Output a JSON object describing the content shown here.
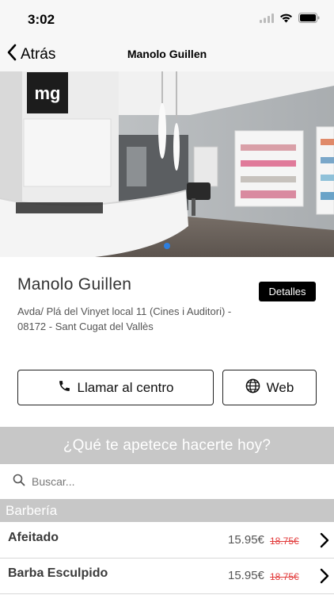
{
  "status_bar": {
    "time": "3:02"
  },
  "nav": {
    "back_label": "Atrás",
    "title": "Manolo Guillen"
  },
  "hero": {
    "logo_text": "mg",
    "pages": 1,
    "current_page": 1
  },
  "salon": {
    "name": "Manolo Guillen",
    "details_label": "Detalles",
    "address": "Avda/ Plá del Vinyet local 11 (Cines i Auditori) - 08172 - Sant Cugat del Vallès"
  },
  "actions": {
    "call_label": "Llamar al centro",
    "web_label": "Web"
  },
  "question": "¿Qué te apetece hacerte hoy?",
  "search": {
    "placeholder": "Buscar..."
  },
  "category": "Barbería",
  "services": [
    {
      "name": "Afeitado",
      "price": "15.95€",
      "old_price": "18.75€"
    },
    {
      "name": "Barba Esculpido",
      "price": "15.95€",
      "old_price": "18.75€"
    }
  ],
  "colors": {
    "accent": "#2d7fe0",
    "band": "#c7c7c7",
    "strike": "#e23b3b"
  },
  "icons": [
    "wifi-icon",
    "battery-icon",
    "signal-icon",
    "back-chevron-icon",
    "phone-icon",
    "globe-icon",
    "search-icon",
    "chevron-right-icon"
  ]
}
